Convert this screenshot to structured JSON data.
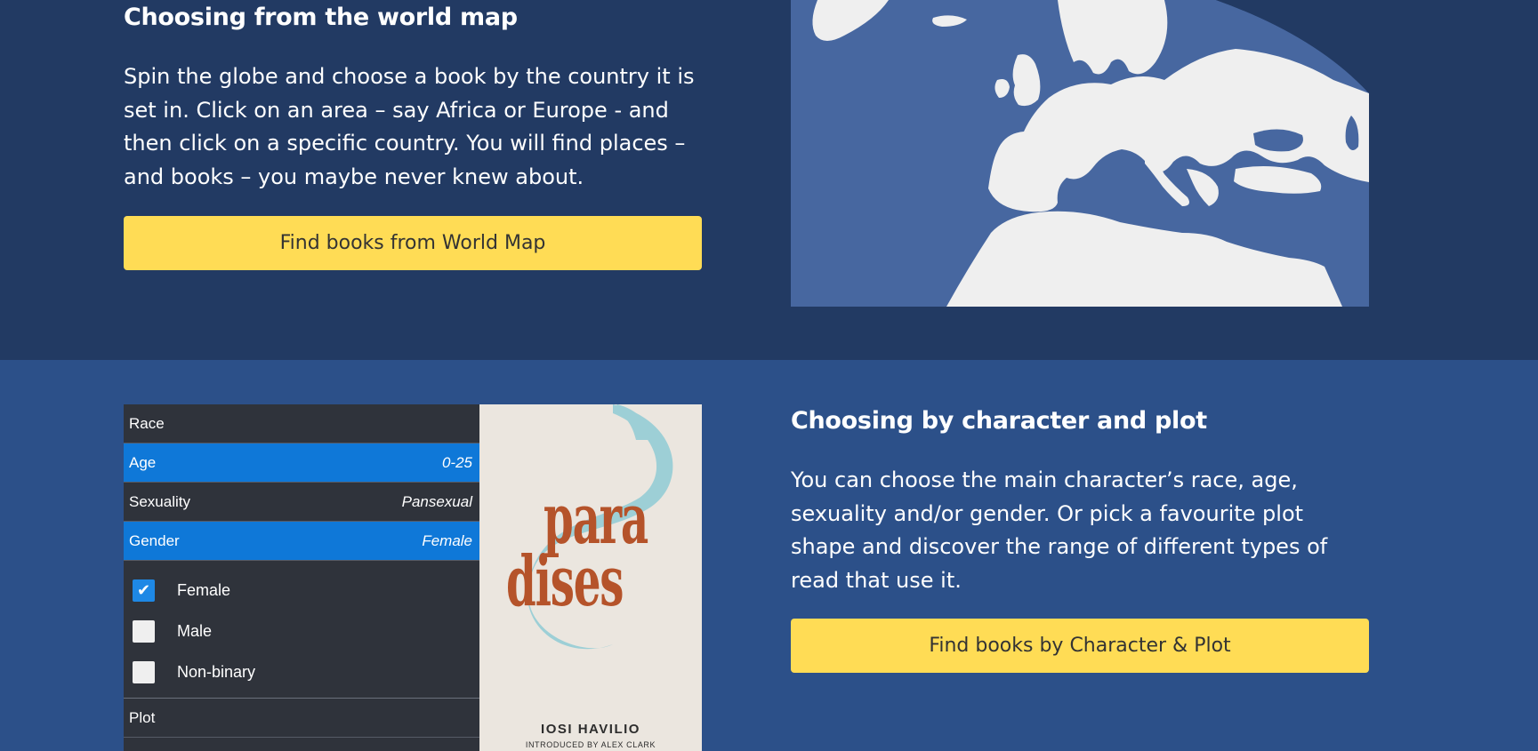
{
  "world_map_section": {
    "heading": "Choosing from the world map",
    "body": "Spin the globe and choose a book by the country it is set in. Click on an area – say Africa or Europe - and then click on a specific country. You will find places – and books – you maybe never knew about.",
    "button_label": "Find books from World Map"
  },
  "character_section": {
    "heading": "Choosing by character and plot",
    "body": "You can choose the main character’s race, age, sexuality and/or gender. Or pick a favourite plot shape and discover the range of different types of read that use it.",
    "button_label": "Find books by Character & Plot"
  },
  "filter_panel": {
    "rows": [
      {
        "label": "Race",
        "value": ""
      },
      {
        "label": "Age",
        "value": "0-25"
      },
      {
        "label": "Sexuality",
        "value": "Pansexual"
      },
      {
        "label": "Gender",
        "value": "Female"
      }
    ],
    "gender_options": [
      {
        "label": "Female",
        "checked": true
      },
      {
        "label": "Male",
        "checked": false
      },
      {
        "label": "Non-binary",
        "checked": false
      }
    ],
    "plot_label": "Plot"
  },
  "book_cover": {
    "title_line1": "para",
    "title_line2": "dises",
    "author": "IOSI HAVILIO",
    "intro": "INTRODUCED BY ALEX CLARK"
  },
  "colors": {
    "top_bg": "#223a63",
    "bottom_bg": "#2c5089",
    "button_bg": "#ffdc55",
    "active_row": "#0f78d8",
    "panel_bg": "#2f333b",
    "sea": "#4767a0",
    "land": "#efefef"
  }
}
